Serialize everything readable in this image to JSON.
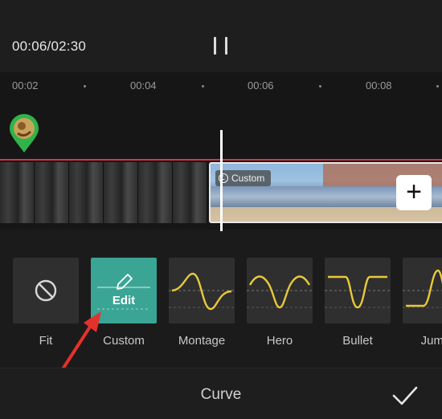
{
  "player": {
    "timecode": "00:06/02:30"
  },
  "ruler": {
    "ticks": [
      "00:02",
      "00:04",
      "00:06",
      "00:08"
    ]
  },
  "timeline": {
    "clip_badge": "Custom",
    "add_icon": "plus-icon"
  },
  "presets": [
    {
      "label": "Fit",
      "icon": "no-entry-icon"
    },
    {
      "label": "Custom",
      "overlay": "Edit",
      "icon": "pencil-icon",
      "selected": true
    },
    {
      "label": "Montage",
      "icon": "curve-icon"
    },
    {
      "label": "Hero",
      "icon": "curve-icon"
    },
    {
      "label": "Bullet",
      "icon": "curve-icon"
    },
    {
      "label": "Jump",
      "icon": "curve-icon"
    }
  ],
  "sheet": {
    "title": "Curve",
    "confirm_icon": "check-icon"
  },
  "colors": {
    "accent": "#3aa595",
    "curve": "#e9c93a",
    "timeline_line": "#d8344a",
    "annotation_arrow": "#e3322b"
  }
}
